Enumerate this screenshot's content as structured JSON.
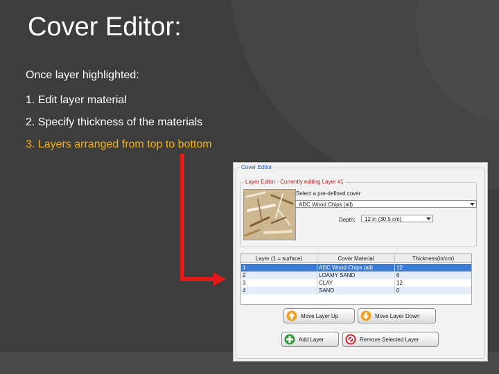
{
  "slide": {
    "title": "Cover Editor:",
    "intro": "Once layer highlighted:",
    "steps": [
      "1.  Edit layer material",
      "2.  Specify thickness of the materials",
      "3.  Layers arranged from top to bottom"
    ],
    "highlight_color": "#f2b21b",
    "arrow_color": "#e31a1a"
  },
  "window": {
    "group_title": "Cover Editor",
    "layer_editor": {
      "title": "Layer Editor - Currently editing Layer #1",
      "select_prompt": "Select a pre-defined cover",
      "selected_cover": "ADC Wood Chips (all)",
      "depth_label": "Depth:",
      "depth_value": "12 in (30.5 cm)"
    },
    "table": {
      "headers": [
        "Layer (1 = surface)",
        "Cover Material",
        "Thickness(in/cm)"
      ],
      "rows": [
        {
          "layer": "1",
          "material": "ADC Wood Chips (all)",
          "thickness": "12",
          "selected": true
        },
        {
          "layer": "2",
          "material": "LOAMY SAND",
          "thickness": "6",
          "selected": false
        },
        {
          "layer": "3",
          "material": "CLAY",
          "thickness": "12",
          "selected": false
        },
        {
          "layer": "4",
          "material": "SAND",
          "thickness": "0",
          "selected": false
        }
      ]
    },
    "buttons": {
      "move_up": "Move Layer Up",
      "move_down": "Move Layer Down",
      "add": "Add Layer",
      "remove": "Remove Selected Layer"
    }
  }
}
